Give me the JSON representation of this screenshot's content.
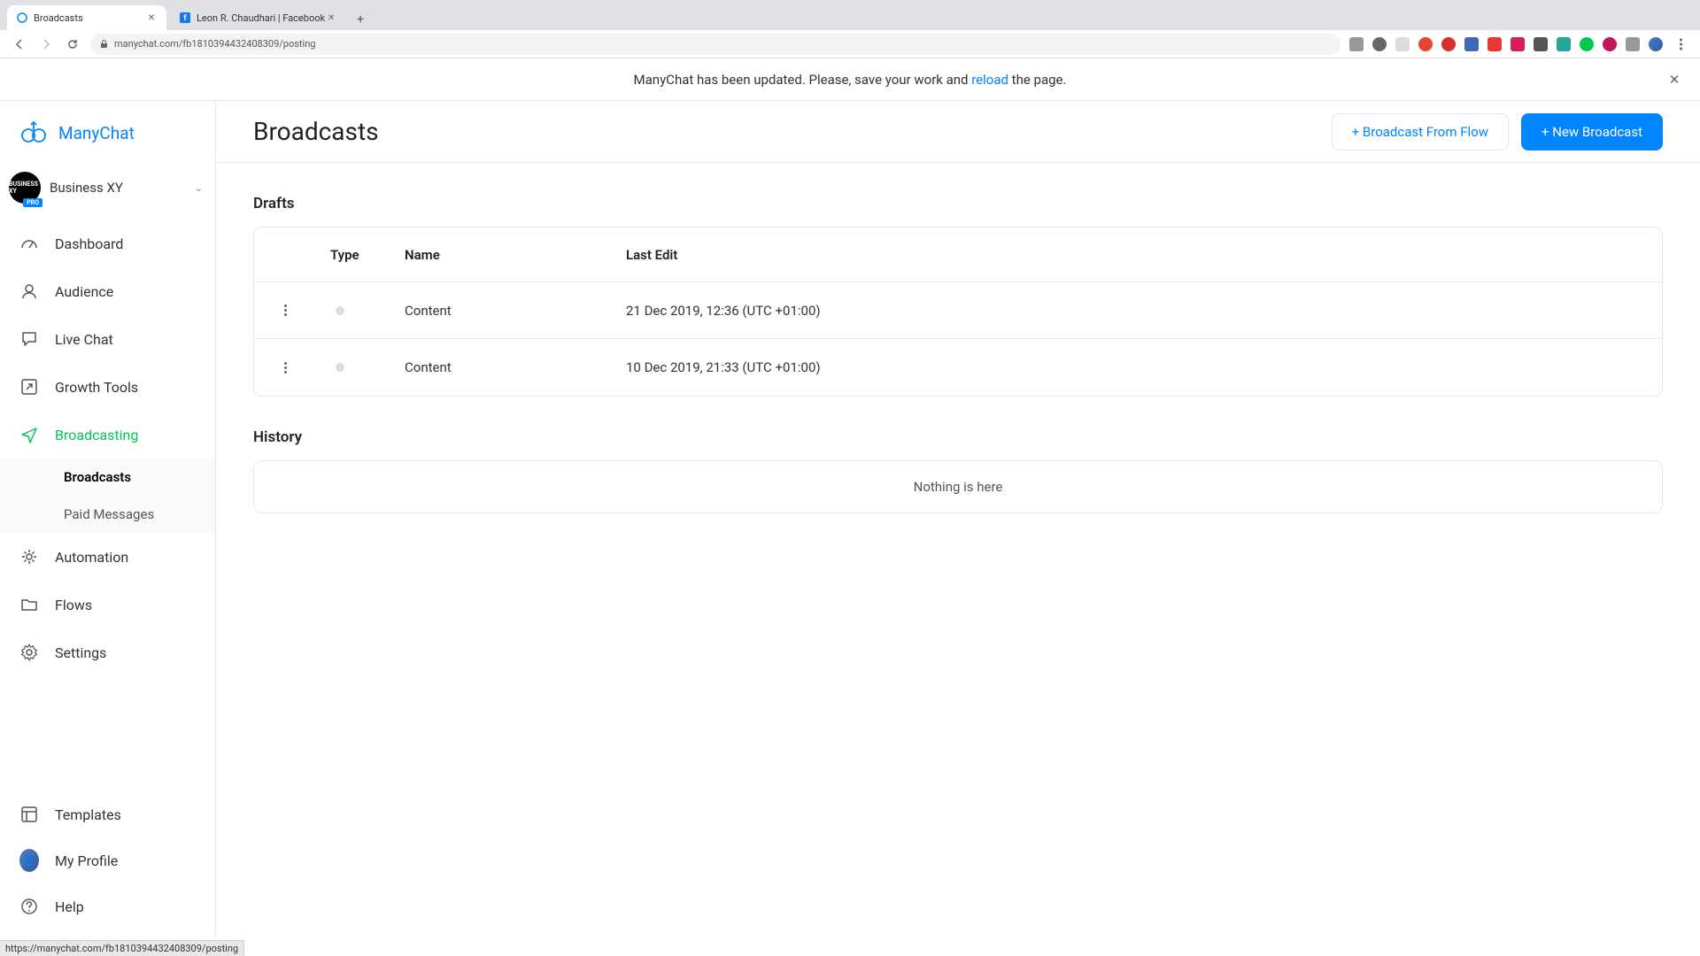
{
  "browser": {
    "tabs": [
      {
        "title": "Broadcasts",
        "icon_color": "#0084ff"
      },
      {
        "title": "Leon R. Chaudhari | Facebook",
        "icon_color": "#1877f2"
      }
    ],
    "url": "manychat.com/fb181039443240​8309/posting"
  },
  "banner": {
    "prefix": "ManyChat has been updated. Please, save your work and ",
    "link": "reload",
    "suffix": " the page."
  },
  "brand": {
    "name": "ManyChat"
  },
  "business": {
    "name": "Business XY",
    "badge": "PRO",
    "avatar_text": "BUSINESS XY"
  },
  "nav": {
    "dashboard": "Dashboard",
    "audience": "Audience",
    "livechat": "Live Chat",
    "growth": "Growth Tools",
    "broadcasting": "Broadcasting",
    "broadcasts": "Broadcasts",
    "paid": "Paid Messages",
    "automation": "Automation",
    "flows": "Flows",
    "settings": "Settings",
    "templates": "Templates",
    "profile": "My Profile",
    "help": "Help"
  },
  "page": {
    "title": "Broadcasts",
    "btn_from_flow": "+ Broadcast From Flow",
    "btn_new": "+ New Broadcast"
  },
  "drafts": {
    "title": "Drafts",
    "cols": {
      "type": "Type",
      "name": "Name",
      "last": "Last Edit"
    },
    "rows": [
      {
        "name": "Content",
        "last": "21 Dec 2019, 12:36 (UTC +01:00)"
      },
      {
        "name": "Content",
        "last": "10 Dec 2019, 21:33 (UTC +01:00)"
      }
    ]
  },
  "history": {
    "title": "History",
    "empty": "Nothing is here"
  },
  "status_url": "https://manychat.com/fb181039443240​8309/posting"
}
